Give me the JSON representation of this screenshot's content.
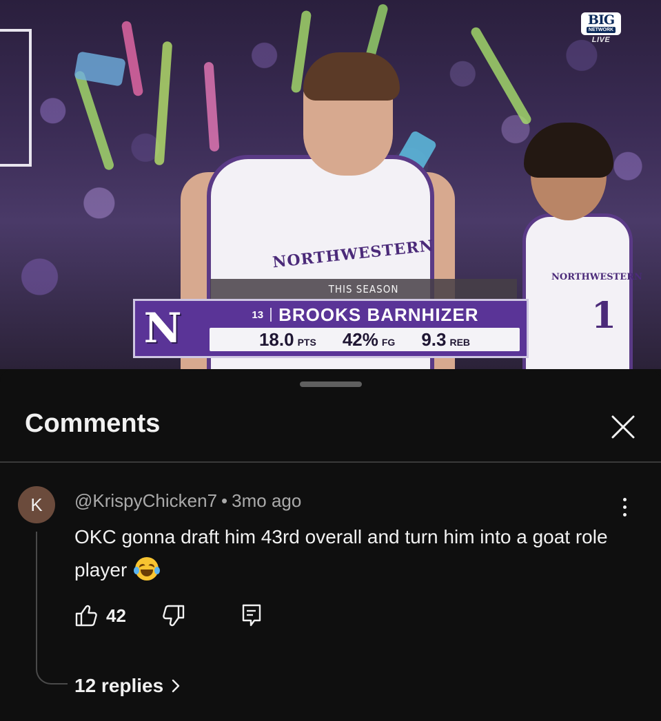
{
  "video": {
    "network_logo": "BIG",
    "network_sub": "NETWORK",
    "live_label": "LIVE",
    "jersey_text": "NORTHWESTERN",
    "jersey_text_2": "NORTHWESTERN",
    "jersey_number": "1",
    "stat_graphic": {
      "season_label": "THIS SEASON",
      "team_logo_letter": "N",
      "player_number": "13",
      "player_name": "BROOKS BARNHIZER",
      "stats": [
        {
          "value": "18.0",
          "unit": "PTS"
        },
        {
          "value": "42%",
          "unit": "FG"
        },
        {
          "value": "9.3",
          "unit": "REB"
        }
      ]
    }
  },
  "comments_panel": {
    "title": "Comments",
    "close_icon": "close-icon",
    "comment": {
      "avatar_letter": "K",
      "author": "@KrispyChicken7",
      "separator": "•",
      "time": "3mo ago",
      "text": "OKC gonna draft him 43rd overall and turn him into a goat role player",
      "emoji": "joy-emoji",
      "like_count": "42",
      "replies_label": "12 replies"
    }
  },
  "colors": {
    "background": "#0f0f0f",
    "text_primary": "#f1f1f1",
    "text_secondary": "#aaaaaa",
    "avatar_bg": "#6b4b3c",
    "team_purple": "#5a3497"
  }
}
